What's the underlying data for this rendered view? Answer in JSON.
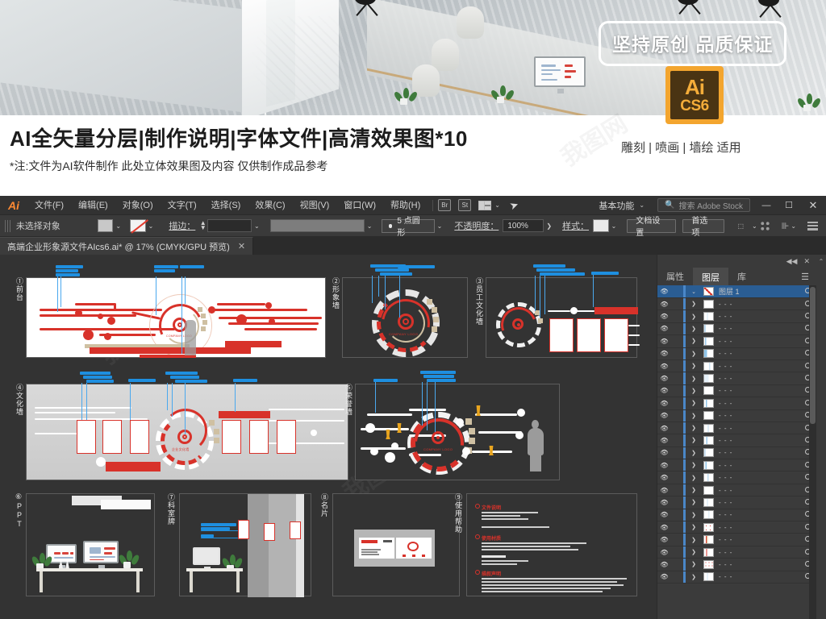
{
  "promo": {
    "ribbon_text": "坚持原创 品质保证",
    "logo_ai": "Ai",
    "logo_cs": "CS6",
    "usage_text": "雕刻 | 喷画 | 墙绘 适用",
    "title": "AI全矢量分层|制作说明|字体文件|高清效果图*10",
    "subtitle": "*注:文件为AI软件制作 此处立体效果图及内容 仅供制作成品参考"
  },
  "menubar": {
    "app_mark": "Ai",
    "items": [
      {
        "label": "文件(F)"
      },
      {
        "label": "编辑(E)"
      },
      {
        "label": "对象(O)"
      },
      {
        "label": "文字(T)"
      },
      {
        "label": "选择(S)"
      },
      {
        "label": "效果(C)"
      },
      {
        "label": "视图(V)"
      },
      {
        "label": "窗口(W)"
      },
      {
        "label": "帮助(H)"
      }
    ],
    "bridge_label": "Br",
    "stock_label": "St",
    "workspace": "基本功能",
    "search_placeholder": "搜索 Adobe Stock",
    "minimize": "—",
    "maximize": "☐",
    "close": "✕"
  },
  "controlbar": {
    "selection_status": "未选择对象",
    "stroke_label": "描边：",
    "brush_label": "5 点圆形",
    "opacity_label": "不透明度：",
    "opacity_value": "100%",
    "style_label": "样式：",
    "doc_setup": "文档设置",
    "preferences": "首选项"
  },
  "document": {
    "tab_title": "高端企业形象源文件AIcs6.ai* @ 17% (CMYK/GPU 预览)",
    "close_glyph": "✕"
  },
  "artboards": [
    {
      "id": "1",
      "num": "①",
      "label": "前台"
    },
    {
      "id": "2",
      "num": "②",
      "label": "形象墙"
    },
    {
      "id": "3",
      "num": "③",
      "label": "员工文化墙"
    },
    {
      "id": "4",
      "num": "④",
      "label": "文化墙"
    },
    {
      "id": "5",
      "num": "⑤",
      "label": "荣誉墙"
    },
    {
      "id": "6",
      "num": "⑥",
      "label": "PPT"
    },
    {
      "id": "7",
      "num": "⑦",
      "label": "科室牌"
    },
    {
      "id": "8",
      "num": "⑧",
      "label": "名片"
    },
    {
      "id": "9",
      "num": "⑨",
      "label": "使用帮助"
    }
  ],
  "artwork": {
    "logo_text": "COMPANY LOGO",
    "slogan_cn": "追求卓越品质 创造世界品牌",
    "slogan_en_1": "PURSUE EXCELLENT QUALITY",
    "slogan_en_2": "CREATE WORLD BRAND",
    "culture_wall_logo": "企业文化墙",
    "help_sections": [
      "文件说明",
      "使用材质",
      "描叙声明"
    ]
  },
  "panel": {
    "collapse_glyph": "◀◀",
    "close_glyph": "✕",
    "tabs": [
      {
        "label": "属性",
        "active": false
      },
      {
        "label": "图层",
        "active": true
      },
      {
        "label": "库",
        "active": false
      }
    ],
    "menu_glyph": "☰",
    "root_layer": "图层 1",
    "sublayer_label": "- - -",
    "sublayer_count": 23,
    "eye_glyph": "👁",
    "chevron_glyph": "❯",
    "expand_glyph": "⌄"
  },
  "colors": {
    "accent_red": "#d8322a",
    "accent_orange": "#f3a52e",
    "panel_bg": "#333333",
    "layer_selected": "#2a5d93",
    "annotation_blue": "#2196e8",
    "tan": "#cfc0a2"
  }
}
